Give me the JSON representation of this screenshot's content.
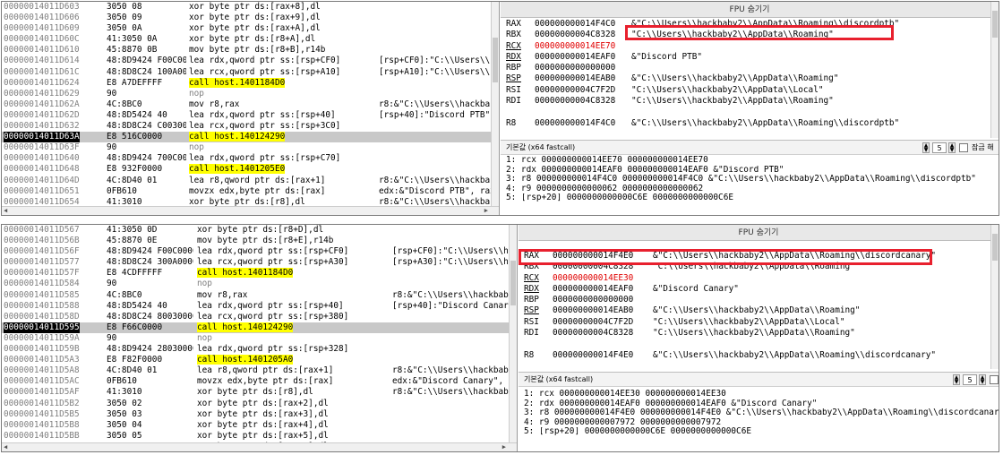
{
  "colors": {
    "call_highlight": "#ffff00",
    "operand_highlight": "#00ffff",
    "red_box": "#e8202e",
    "changed_reg": "#e00000",
    "selected_addr_bg": "#000000"
  },
  "panels": [
    {
      "disasm": [
        {
          "addr": "00000014011D603",
          "bytes": "3050 08",
          "instr": "xor byte ptr ds:[rax+8],dl",
          "hl": "",
          "cmt": ""
        },
        {
          "addr": "00000014011D606",
          "bytes": "3050 09",
          "instr": "xor byte ptr ds:[rax+9],dl",
          "hl": "",
          "cmt": ""
        },
        {
          "addr": "00000014011D609",
          "bytes": "3050 0A",
          "instr": "xor byte ptr ds:[rax+A],dl",
          "hl": "",
          "cmt": ""
        },
        {
          "addr": "00000014011D60C",
          "bytes": "41:3050 0A",
          "instr": "xor byte ptr ds:[r8+A],dl",
          "hl": "",
          "cmt": ""
        },
        {
          "addr": "00000014011D610",
          "bytes": "45:8870 0B",
          "instr": "mov byte ptr ds:[r8+B],r14b",
          "hl": "",
          "cmt": ""
        },
        {
          "addr": "00000014011D614",
          "bytes": "48:8D9424 F00C0000",
          "instr": "lea rdx,qword ptr ss:[rsp+CF0]",
          "hl": "",
          "cmt": "[rsp+CF0]:\"C:\\\\Users\\\\ha"
        },
        {
          "addr": "00000014011D61C",
          "bytes": "48:8D8C24 100A0000",
          "instr": "lea rcx,qword ptr ss:[rsp+A10]",
          "hl": "",
          "cmt": "[rsp+A10]:\"C:\\\\Users\\\\ha"
        },
        {
          "addr": "00000014011D624",
          "bytes": "E8 A7DEFFFF",
          "instr": "call host.1401184D0",
          "hl": "call",
          "cmt": ""
        },
        {
          "addr": "00000014011D629",
          "bytes": "90",
          "instr": "nop",
          "hl": "nop",
          "cmt": ""
        },
        {
          "addr": "00000014011D62A",
          "bytes": "4C:8BC0",
          "instr": "mov r8,rax",
          "hl": "",
          "cmt": "r8:&\"C:\\\\Users\\\\hackbaby"
        },
        {
          "addr": "00000014011D62D",
          "bytes": "48:8D5424 40",
          "instr": "lea rdx,qword ptr ss:[rsp+40]",
          "hl": "",
          "cmt": "[rsp+40]:\"Discord PTB\""
        },
        {
          "addr": "00000014011D632",
          "bytes": "48:8D8C24 C0030000",
          "instr": "lea rcx,qword ptr ss:[rsp+3C0]",
          "hl": "",
          "cmt": ""
        },
        {
          "addr": "00000014011D63A",
          "bytes": "E8 516C0000",
          "instr": "call host.140124290",
          "hl": "call",
          "cmt": "",
          "sel": true
        },
        {
          "addr": "00000014011D63F",
          "bytes": "90",
          "instr": "nop",
          "hl": "nop",
          "cmt": ""
        },
        {
          "addr": "00000014011D640",
          "bytes": "48:8D9424 700C0000",
          "instr": "lea rdx,qword ptr ss:[rsp+C70]",
          "hl": "",
          "cmt": ""
        },
        {
          "addr": "00000014011D648",
          "bytes": "E8 932F0000",
          "instr": "call host.1401205E0",
          "hl": "call",
          "cmt": ""
        },
        {
          "addr": "00000014011D64D",
          "bytes": "4C:8D40 01",
          "instr": "lea r8,qword ptr ds:[rax+1]",
          "hl": "",
          "cmt": "r8:&\"C:\\\\Users\\\\hackbaby"
        },
        {
          "addr": "00000014011D651",
          "bytes": "0FB610",
          "instr": "movzx edx,byte ptr ds:[rax]",
          "hl": "",
          "cmt": "edx:&\"Discord PTB\", rax:"
        },
        {
          "addr": "00000014011D654",
          "bytes": "41:3010",
          "instr": "xor byte ptr ds:[r8],dl",
          "hl": "",
          "cmt": "r8:&\"C:\\\\Users\\\\hackbaby"
        },
        {
          "addr": "00000014011D657",
          "bytes": "3050 02",
          "instr": "xor byte ptr ds:[rax+2],dl",
          "hl": "",
          "cmt": ""
        },
        {
          "addr": "00000014011D65A",
          "bytes": "3050 03",
          "instr": "xor byte ptr ds:[rax+3],dl",
          "hl": "",
          "cmt": ""
        }
      ],
      "fpu_title": "FPU 숨기기",
      "registers": [
        {
          "name": "RAX",
          "value": "000000000014F4C0",
          "str": "&\"C:\\\\Users\\\\hackbaby2\\\\AppData\\\\Roaming\\\\discordptb\""
        },
        {
          "name": "RBX",
          "value": "00000000004C8328",
          "str": "\"C:\\\\Users\\\\hackbaby2\\\\AppData\\\\Roaming\""
        },
        {
          "name": "RCX",
          "value": "000000000014EE70",
          "str": "",
          "changed": true
        },
        {
          "name": "RDX",
          "value": "000000000014EAF0",
          "str": "&\"Discord PTB\""
        },
        {
          "name": "RBP",
          "value": "0000000000000000",
          "str": ""
        },
        {
          "name": "RSP",
          "value": "000000000014EAB0",
          "str": "&\"C:\\\\Users\\\\hackbaby2\\\\AppData\\\\Roaming\""
        },
        {
          "name": "RSI",
          "value": "00000000004C7F2D",
          "str": "\"C:\\\\Users\\\\hackbaby2\\\\AppData\\\\Local\""
        },
        {
          "name": "RDI",
          "value": "00000000004C8328",
          "str": "\"C:\\\\Users\\\\hackbaby2\\\\AppData\\\\Roaming\""
        },
        {
          "name": "",
          "value": "",
          "str": ""
        },
        {
          "name": "R8",
          "value": "000000000014F4C0",
          "str": "&\"C:\\\\Users\\\\hackbaby2\\\\AppData\\\\Roaming\\\\discordptb\""
        }
      ],
      "callconv": "기본값 (x64 fastcall)",
      "arg_count": "5",
      "unlock_label": "잠금 해제",
      "callargs": [
        "1: rcx 000000000014EE70 000000000014EE70",
        "2: rdx 000000000014EAF0 000000000014EAF0 &\"Discord PTB\"",
        "3: r8 000000000014F4C0 000000000014F4C0 &\"C:\\\\Users\\\\hackbaby2\\\\AppData\\\\Roaming\\\\discordptb\"",
        "4: r9 0000000000000062 0000000000000062",
        "5: [rsp+20] 0000000000000C6E 0000000000000C6E"
      ]
    },
    {
      "disasm": [
        {
          "addr": "00000014011D567",
          "bytes": "41:3050 0D",
          "instr": "xor byte ptr ds:[r8+D],dl",
          "hl": "",
          "cmt": ""
        },
        {
          "addr": "00000014011D56B",
          "bytes": "45:8870 0E",
          "instr": "mov byte ptr ds:[r8+E],r14b",
          "hl": "",
          "cmt": ""
        },
        {
          "addr": "00000014011D56F",
          "bytes": "48:8D9424 F00C0000",
          "instr": "lea rdx,qword ptr ss:[rsp+CF0]",
          "hl": "",
          "cmt": "[rsp+CF0]:\"C:\\\\Users\\\\ha"
        },
        {
          "addr": "00000014011D577",
          "bytes": "48:8D8C24 300A0000",
          "instr": "lea rcx,qword ptr ss:[rsp+A30]",
          "hl": "",
          "cmt": "[rsp+A30]:\"C:\\\\Users\\\\ha"
        },
        {
          "addr": "00000014011D57F",
          "bytes": "E8 4CDFFFFF",
          "instr": "call host.1401184D0",
          "hl": "call",
          "cmt": ""
        },
        {
          "addr": "00000014011D584",
          "bytes": "90",
          "instr": "nop",
          "hl": "nop",
          "cmt": ""
        },
        {
          "addr": "00000014011D585",
          "bytes": "4C:8BC0",
          "instr": "mov r8,rax",
          "hl": "",
          "cmt": "r8:&\"C:\\\\Users\\\\hackbaby"
        },
        {
          "addr": "00000014011D588",
          "bytes": "48:8D5424 40",
          "instr": "lea rdx,qword ptr ss:[rsp+40]",
          "hl": "",
          "cmt": "[rsp+40]:\"Discord Canary"
        },
        {
          "addr": "00000014011D58D",
          "bytes": "48:8D8C24 80030000",
          "instr": "lea rcx,qword ptr ss:[rsp+380]",
          "hl": "",
          "cmt": ""
        },
        {
          "addr": "00000014011D595",
          "bytes": "E8 F66C0000",
          "instr": "call host.140124290",
          "hl": "call",
          "cmt": "",
          "sel": true
        },
        {
          "addr": "00000014011D59A",
          "bytes": "90",
          "instr": "nop",
          "hl": "nop",
          "cmt": ""
        },
        {
          "addr": "00000014011D59B",
          "bytes": "48:8D9424 28030000",
          "instr": "lea rdx,qword ptr ss:[rsp+328]",
          "hl": "",
          "cmt": ""
        },
        {
          "addr": "00000014011D5A3",
          "bytes": "E8 F82F0000",
          "instr": "call host.1401205A0",
          "hl": "call",
          "cmt": ""
        },
        {
          "addr": "00000014011D5A8",
          "bytes": "4C:8D40 01",
          "instr": "lea r8,qword ptr ds:[rax+1]",
          "hl": "",
          "cmt": "r8:&\"C:\\\\Users\\\\hackbaby"
        },
        {
          "addr": "00000014011D5AC",
          "bytes": "0FB610",
          "instr": "movzx edx,byte ptr ds:[rax]",
          "hl": "",
          "cmt": "edx:&\"Discord Canary\", r"
        },
        {
          "addr": "00000014011D5AF",
          "bytes": "41:3010",
          "instr": "xor byte ptr ds:[r8],dl",
          "hl": "",
          "cmt": "r8:&\"C:\\\\Users\\\\hackbaby"
        },
        {
          "addr": "00000014011D5B2",
          "bytes": "3050 02",
          "instr": "xor byte ptr ds:[rax+2],dl",
          "hl": "",
          "cmt": ""
        },
        {
          "addr": "00000014011D5B5",
          "bytes": "3050 03",
          "instr": "xor byte ptr ds:[rax+3],dl",
          "hl": "",
          "cmt": ""
        },
        {
          "addr": "00000014011D5B8",
          "bytes": "3050 04",
          "instr": "xor byte ptr ds:[rax+4],dl",
          "hl": "",
          "cmt": ""
        },
        {
          "addr": "00000014011D5BB",
          "bytes": "3050 05",
          "instr": "xor byte ptr ds:[rax+5],dl",
          "hl": "",
          "cmt": ""
        },
        {
          "addr": "00000014011D5BE",
          "bytes": "3050 06",
          "instr": "xor byte ptr ds:[rax+6],dl",
          "hl": "",
          "cmt": ""
        }
      ],
      "fpu_title": "FPU 숨기기",
      "registers": [
        {
          "name": "RAX",
          "value": "000000000014F4E0",
          "str": "&\"C:\\\\Users\\\\hackbaby2\\\\AppData\\\\Roaming\\\\discordcanary\""
        },
        {
          "name": "RBX",
          "value": "00000000004C8328",
          "str": "\"C:\\\\Users\\\\hackbaby2\\\\AppData\\\\Roaming\""
        },
        {
          "name": "RCX",
          "value": "000000000014EE30",
          "str": "",
          "changed": true
        },
        {
          "name": "RDX",
          "value": "000000000014EAF0",
          "str": "&\"Discord Canary\""
        },
        {
          "name": "RBP",
          "value": "0000000000000000",
          "str": ""
        },
        {
          "name": "RSP",
          "value": "000000000014EAB0",
          "str": "&\"C:\\\\Users\\\\hackbaby2\\\\AppData\\\\Roaming\""
        },
        {
          "name": "RSI",
          "value": "00000000004C7F2D",
          "str": "\"C:\\\\Users\\\\hackbaby2\\\\AppData\\\\Local\""
        },
        {
          "name": "RDI",
          "value": "00000000004C8328",
          "str": "\"C:\\\\Users\\\\hackbaby2\\\\AppData\\\\Roaming\""
        },
        {
          "name": "",
          "value": "",
          "str": ""
        },
        {
          "name": "R8",
          "value": "000000000014F4E0",
          "str": "&\"C:\\\\Users\\\\hackbaby2\\\\AppData\\\\Roaming\\\\discordcanary\""
        }
      ],
      "callconv": "기본값 (x64 fastcall)",
      "arg_count": "5",
      "unlock_label": "",
      "callargs": [
        "1: rcx 000000000014EE30 000000000014EE30",
        "2: rdx 000000000014EAF0 000000000014EAF0 &\"Discord Canary\"",
        "3: r8 000000000014F4E0 000000000014F4E0 &\"C:\\\\Users\\\\hackbaby2\\\\AppData\\\\Roaming\\\\discordcanary\"",
        "4: r9 0000000000007972 0000000000007972",
        "5: [rsp+20] 0000000000000C6E 0000000000000C6E"
      ]
    }
  ]
}
